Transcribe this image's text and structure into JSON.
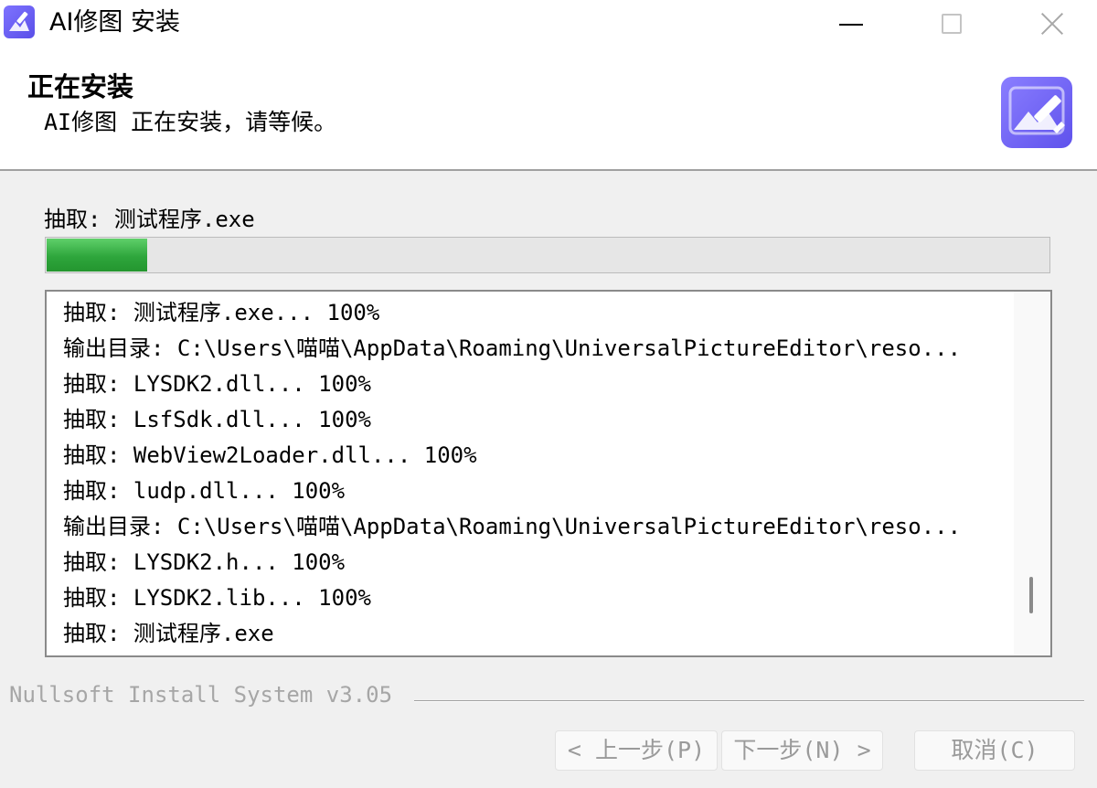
{
  "window": {
    "title": "AI修图 安装",
    "icon": "app-logo-icon"
  },
  "header": {
    "title": "正在安装",
    "subtitle": "AI修图 正在安装，请等候。",
    "logo_icon": "image-edit-logo-icon"
  },
  "status": {
    "text": "抽取: 测试程序.exe",
    "progress_percent": 10
  },
  "log": {
    "lines": [
      "抽取: 测试程序.exe... 100%",
      "输出目录: C:\\Users\\喵喵\\AppData\\Roaming\\UniversalPictureEditor\\reso...",
      "抽取: LYSDK2.dll... 100%",
      "抽取: LsfSdk.dll... 100%",
      "抽取: WebView2Loader.dll... 100%",
      "抽取: ludp.dll... 100%",
      "输出目录: C:\\Users\\喵喵\\AppData\\Roaming\\UniversalPictureEditor\\reso...",
      "抽取: LYSDK2.h... 100%",
      "抽取: LYSDK2.lib... 100%",
      "抽取: 测试程序.exe"
    ]
  },
  "footer": {
    "brand": "Nullsoft Install System v3.05",
    "back_label": "< 上一步(P)",
    "next_label": "下一步(N) >",
    "cancel_label": "取消(C)"
  },
  "colors": {
    "progress": "#2ea63c",
    "logo": "#6a5ef0"
  }
}
